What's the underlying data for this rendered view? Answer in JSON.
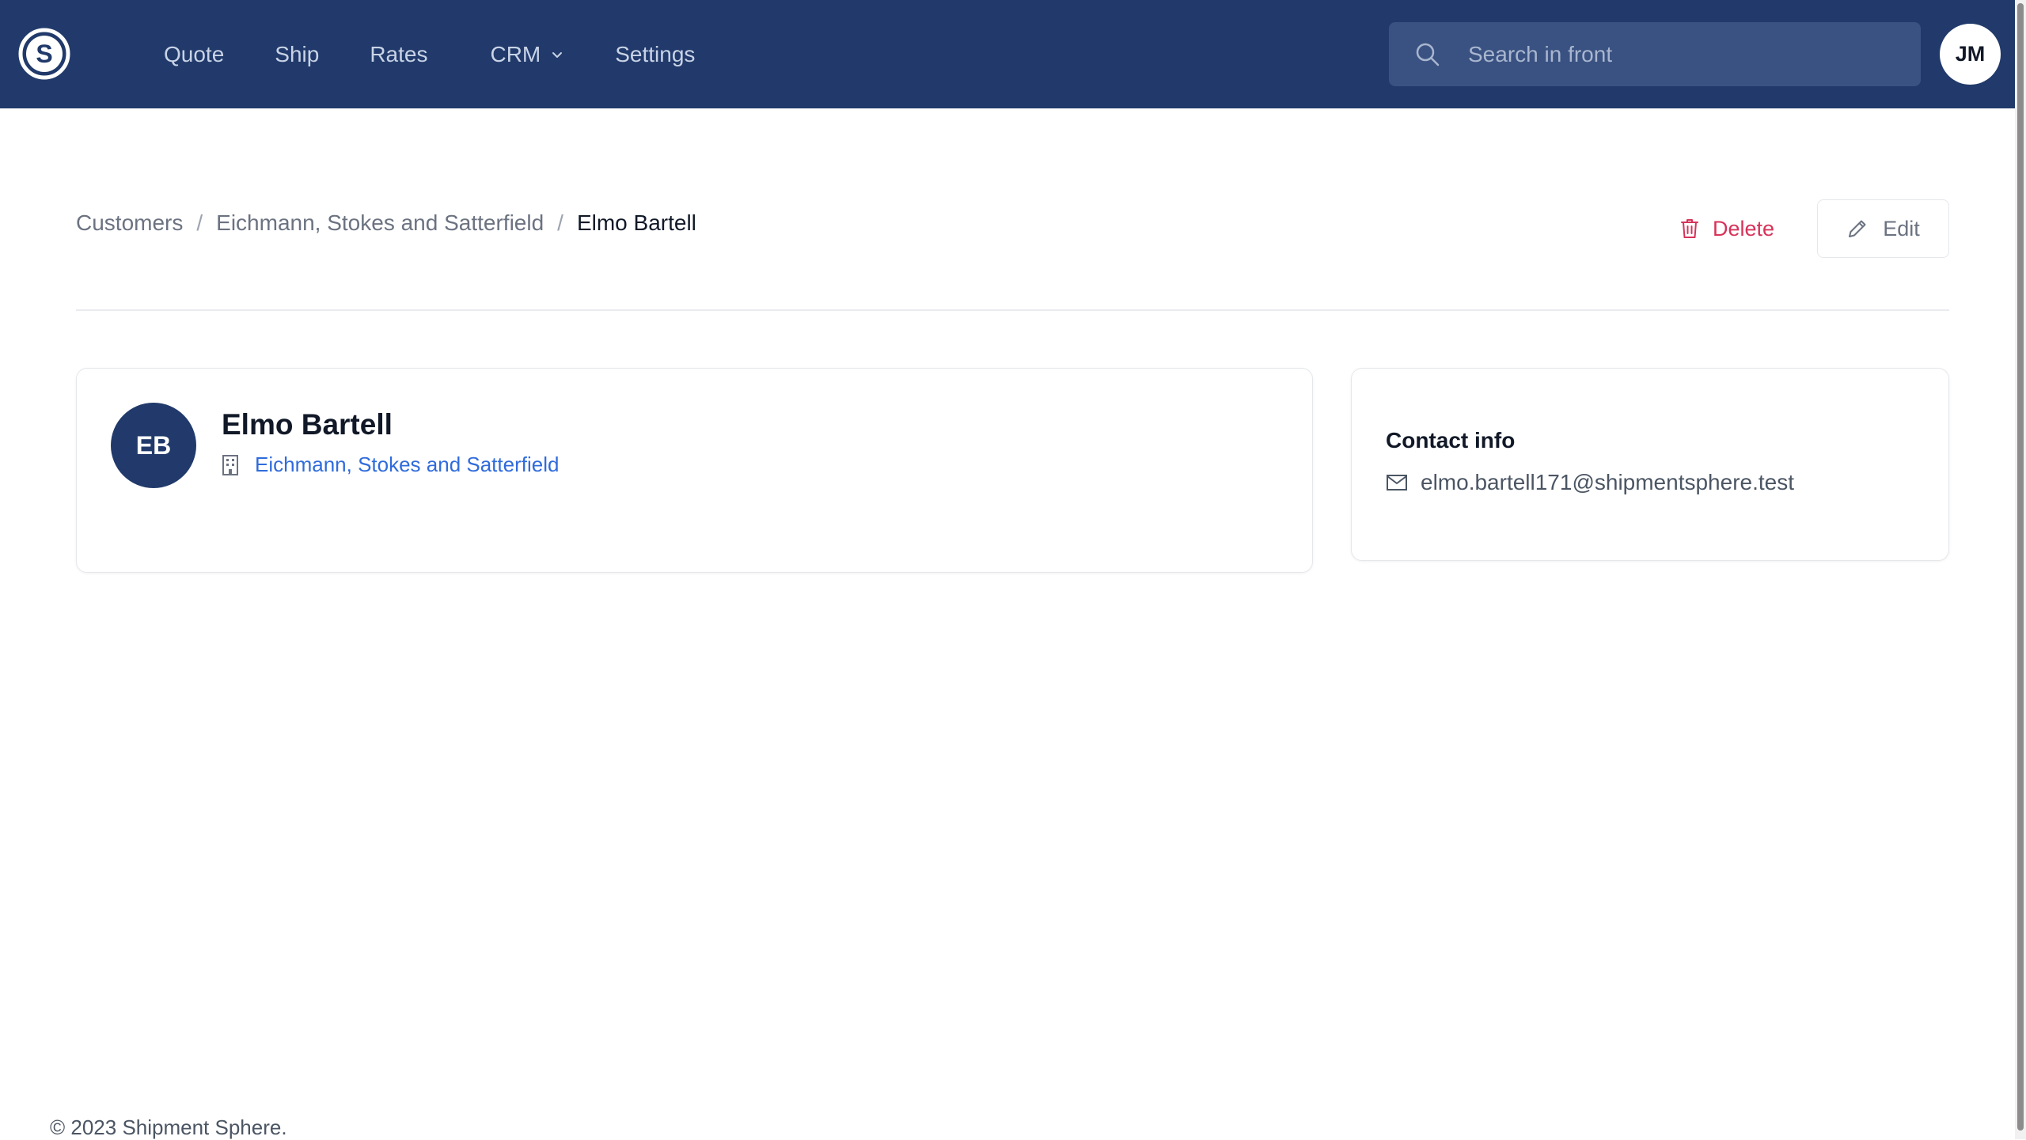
{
  "nav": {
    "items": [
      {
        "label": "Quote"
      },
      {
        "label": "Ship"
      },
      {
        "label": "Rates"
      },
      {
        "label": "CRM"
      },
      {
        "label": "Settings"
      }
    ],
    "search_placeholder": "Search in front",
    "user_initials": "JM",
    "logo_icon": "shipment-sphere-logo-icon"
  },
  "breadcrumb": {
    "items": [
      {
        "label": "Customers"
      },
      {
        "label": "Eichmann, Stokes and Satterfield"
      },
      {
        "label": "Elmo Bartell"
      }
    ],
    "separator": "/"
  },
  "actions": {
    "delete_label": "Delete",
    "edit_label": "Edit"
  },
  "profile": {
    "initials": "EB",
    "name": "Elmo Bartell",
    "company": "Eichmann, Stokes and Satterfield"
  },
  "contact": {
    "title": "Contact info",
    "email": "elmo.bartell171@shipmentsphere.test"
  },
  "footer": {
    "copyright": "© 2023 Shipment Sphere."
  },
  "colors": {
    "nav_bg": "#213a6b",
    "accent_link": "#2f6bdc",
    "danger": "#d7335a"
  }
}
